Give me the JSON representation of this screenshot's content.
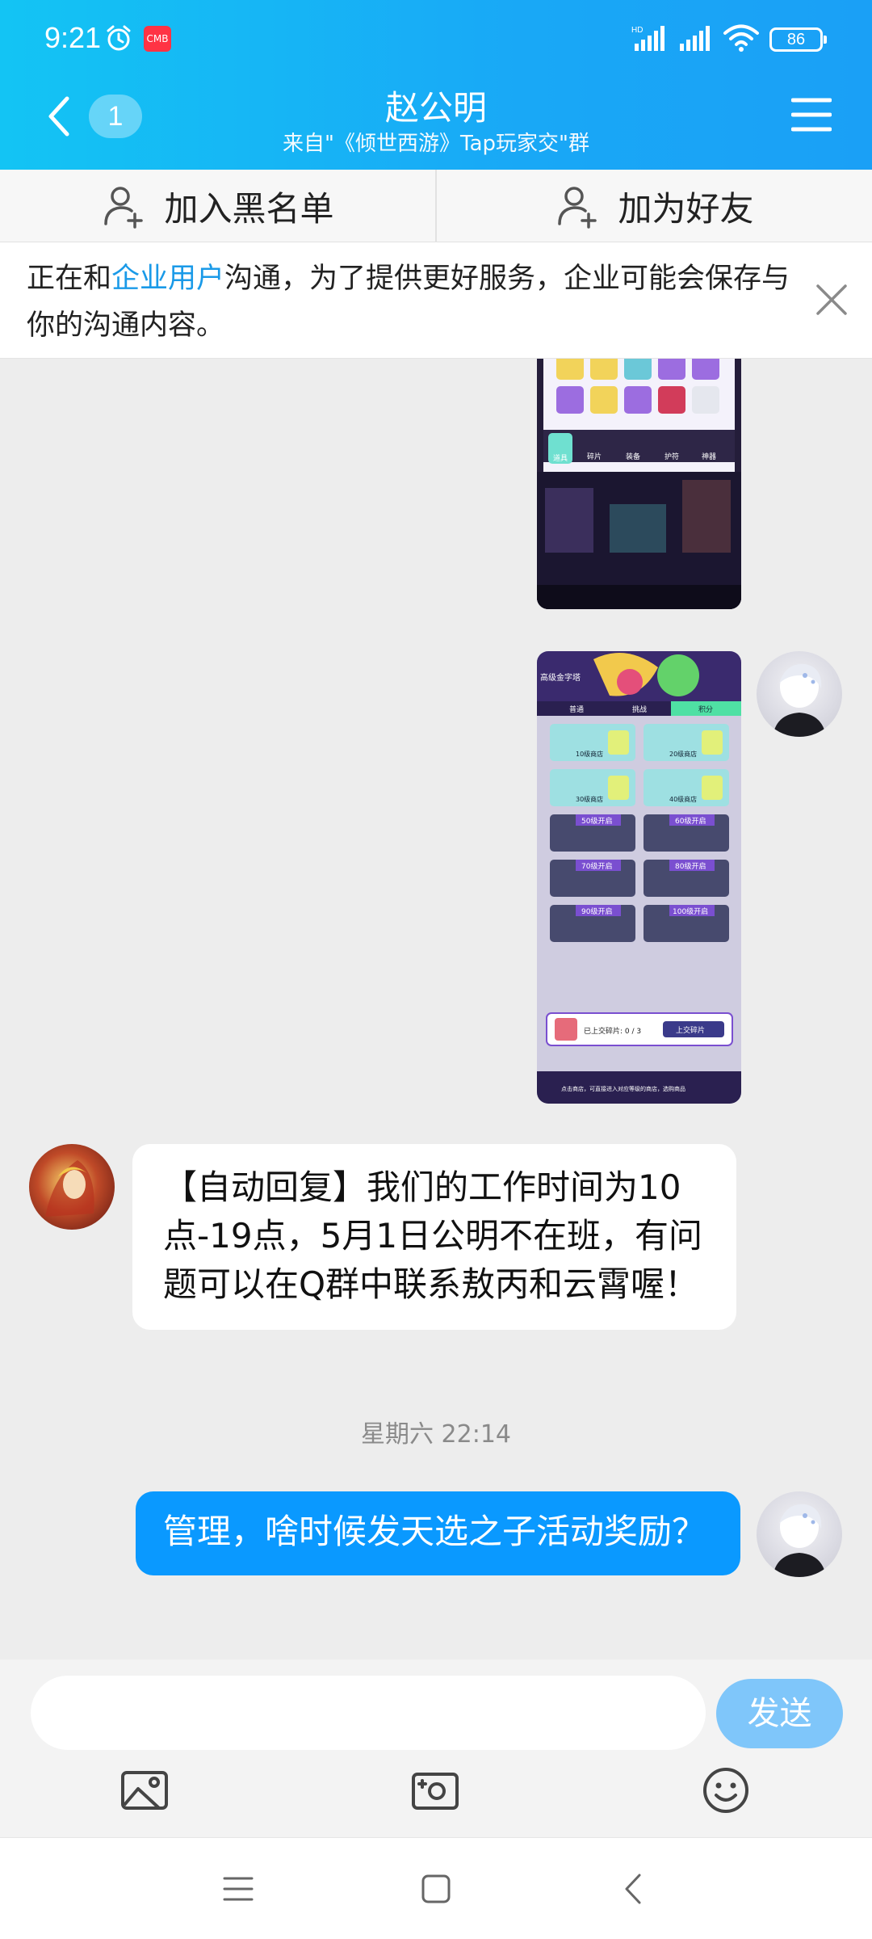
{
  "status_bar": {
    "time": "9:21",
    "app_badge": "CMB",
    "battery": "86",
    "network": "HD"
  },
  "header": {
    "unread_count": "1",
    "title": "赵公明",
    "subtitle": "来自\"《倾世西游》Tap玩家交\"群"
  },
  "actions": {
    "blacklist_label": "加入黑名单",
    "add_friend_label": "加为好友"
  },
  "notice": {
    "prefix": "正在和",
    "highlight": "企业用户",
    "suffix": "沟通，为了提供更好服务，企业可能会保存与你的沟通内容。"
  },
  "messages": {
    "auto_reply": "【自动回复】我们的工作时间为10点-19点，5月1日公明不在班，有问题可以在Q群中联系敖丙和云霄喔！",
    "timestamp": "星期六 22:14",
    "outgoing": "管理，啥时候发天选之子活动奖励？"
  },
  "screenshot_2": {
    "header_label": "高级金字塔",
    "tabs": [
      "普通",
      "挑战",
      "积分"
    ],
    "shops_open": [
      "10级商店",
      "20级商店",
      "30级商店",
      "40级商店"
    ],
    "shops_locked": [
      "50级开启",
      "60级开启",
      "70级开启",
      "80级开启",
      "90级开启",
      "100级开启"
    ],
    "fragment_label": "已上交碎片: 0 / 3",
    "submit_label": "上交碎片",
    "footer": "点击商店，可直接进入对应等级的商店，选购商品"
  },
  "screenshot_1": {
    "tabs": [
      "道具",
      "碎片",
      "装备",
      "护符",
      "神器"
    ]
  },
  "input": {
    "placeholder": "",
    "send_label": "发送"
  },
  "colors": {
    "header_start": "#13c4f4",
    "header_end": "#1aa0f6",
    "accent": "#0a99ff",
    "send_disabled": "#7fc6fa"
  }
}
